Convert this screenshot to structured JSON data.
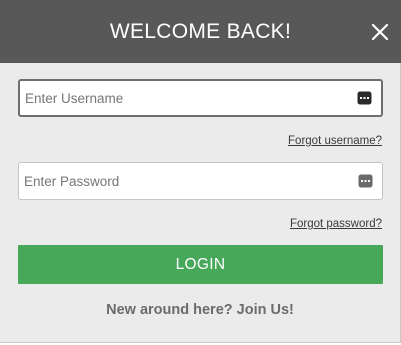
{
  "header": {
    "title": "WELCOME BACK!",
    "close_icon": "close-icon"
  },
  "username": {
    "value": "",
    "placeholder": "Enter Username",
    "icon": "password-manager-key-icon"
  },
  "password": {
    "value": "",
    "placeholder": "Enter Password",
    "icon": "password-manager-key-icon"
  },
  "links": {
    "forgot_username": "Forgot username?",
    "forgot_password": "Forgot password?",
    "join": "New around here? Join Us!"
  },
  "login_button": {
    "label": "LOGIN"
  },
  "colors": {
    "header_bg": "#585858",
    "modal_bg": "#ebebeb",
    "accent_green": "#47a85a"
  }
}
